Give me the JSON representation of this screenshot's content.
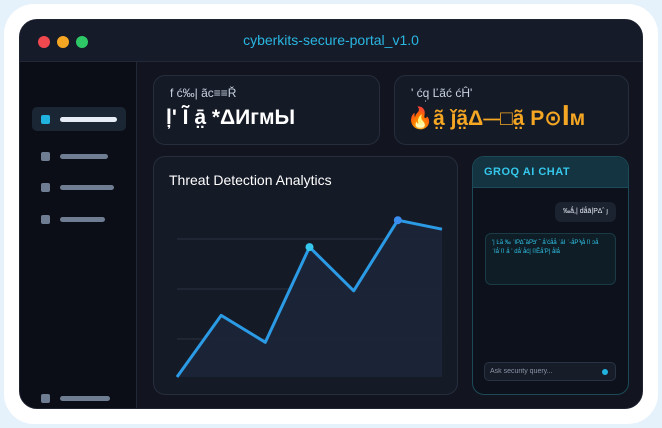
{
  "window": {
    "title": "cyberkits-secure-portal_v1.0"
  },
  "stats": [
    {
      "label": "f ć‰| ãc≡≡Ř",
      "value": "ļ' Ĩ ā̤ *ΔИᴦмЫ"
    },
    {
      "label": "' ćq̣ Ľãć ćĤ'",
      "value": "🔥ã̤ ǰã̤Δ⏤□ã̤ Ρ⊙ꟾм"
    }
  ],
  "chart": {
    "title": "Threat Detection Analytics",
    "line_color": "#2b9be6"
  },
  "chart_data": {
    "type": "area",
    "title": "Threat Detection Analytics",
    "xlabel": "",
    "ylabel": "",
    "grid": true,
    "x": [
      0,
      1,
      2,
      3,
      4,
      5,
      6
    ],
    "values": [
      0,
      55,
      31,
      116,
      77,
      140,
      132
    ],
    "highlighted_points": [
      3,
      5
    ],
    "ylim": [
      0,
      150
    ]
  },
  "chat": {
    "header": "GROQ AI CHAT",
    "user_message": "‰ǻ,| dǻā|Ρ∆ˆ ȷ",
    "bot_message": "'| Ŀã ‰ ˈΙΡΔˆâΡ̈ϧ' ˆ ǻʼćǻǻ ˈāΙ ˈ-ǻΡϡǻ ⌷ ɔǻ ˈΙǻ˙⌷ ǻ ʼ dǻ˙ǻć| ⌷ĒǻʼΡ| ǻlǻ",
    "input_placeholder": "Ask security query..."
  },
  "colors": {
    "accent": "#21b3df",
    "orange": "#f5a623",
    "background": "#12151f"
  }
}
